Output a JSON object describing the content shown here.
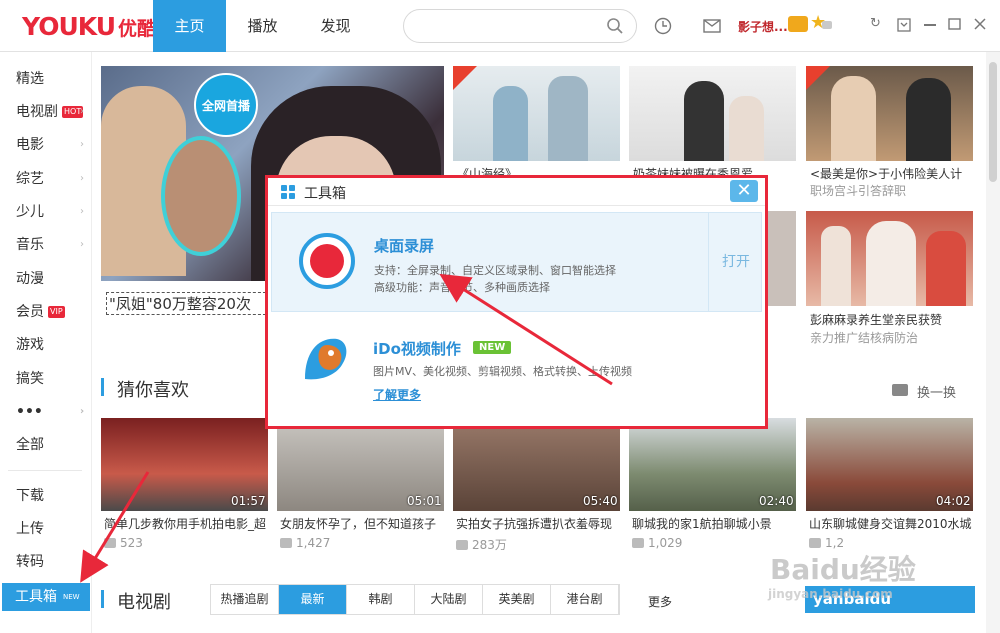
{
  "app": {
    "logo_en": "YOUKU",
    "logo_cn": "优酷"
  },
  "nav": [
    "主页",
    "播放",
    "发现"
  ],
  "user": {
    "name": "影子想..."
  },
  "sidebar": {
    "items": [
      "精选",
      "电视剧",
      "电影",
      "综艺",
      "少儿",
      "音乐",
      "动漫",
      "会员",
      "游戏",
      "搞笑",
      "•••",
      "全部"
    ],
    "hot_badge": "HOT",
    "vip_badge": "VIP",
    "bottom": [
      "下载",
      "上传",
      "转码"
    ],
    "toolbox": "工具箱",
    "toolbox_new": "NEW"
  },
  "hero": {
    "badge_line1": "全网首播",
    "caption": "\"凤姐\"80万整容20次"
  },
  "top_cards": [
    {
      "title": "《山海经》",
      "sub": ""
    },
    {
      "title": "奶茶妹妹被曝在秀恩爱",
      "sub": ""
    },
    {
      "title": "<最美是你>于小伟险美人计",
      "sub": "职场宫斗引答辞职"
    },
    {
      "title": "",
      "sub": ""
    },
    {
      "title": "彭麻麻录养生堂亲民获赞",
      "sub": "亲力推广结核病防治"
    }
  ],
  "guess": {
    "title": "猜你喜欢",
    "refresh": "换一换",
    "cards": [
      {
        "title": "简单几步教你用手机拍电影_超",
        "count": "523",
        "duration": "01:57"
      },
      {
        "title": "女朋友怀孕了，但不知道孩子",
        "count": "1,427",
        "duration": "05:01"
      },
      {
        "title": "实拍女子抗强拆遭扒衣羞辱现",
        "count": "283万",
        "duration": "05:40"
      },
      {
        "title": "聊城我的家1航拍聊城小景",
        "count": "1,029",
        "duration": "02:40"
      },
      {
        "title": "山东聊城健身交谊舞2010水城",
        "count": "1,2",
        "duration": "04:02"
      }
    ]
  },
  "tv": {
    "title": "电视剧",
    "tabs": [
      "热播追剧",
      "最新",
      "韩剧",
      "大陆剧",
      "英美剧",
      "港台剧"
    ],
    "more": "更多"
  },
  "dialog": {
    "title": "工具箱",
    "close": "✕",
    "tool1": {
      "name": "桌面录屏",
      "desc1": "支持：全屏录制、自定义区域录制、窗口智能选择",
      "desc2": "高级功能：声音调节、多种画质选择",
      "open": "打开"
    },
    "tool2": {
      "name": "iDo视频制作",
      "tag": "NEW",
      "desc": "图片MV、美化视频、剪辑视频、格式转换、上传视频",
      "more": "了解更多"
    }
  },
  "watermark": {
    "line1": "Baidu经验",
    "line2": "jingyan.baidu.com"
  },
  "overlay_text": "yanbaidu"
}
